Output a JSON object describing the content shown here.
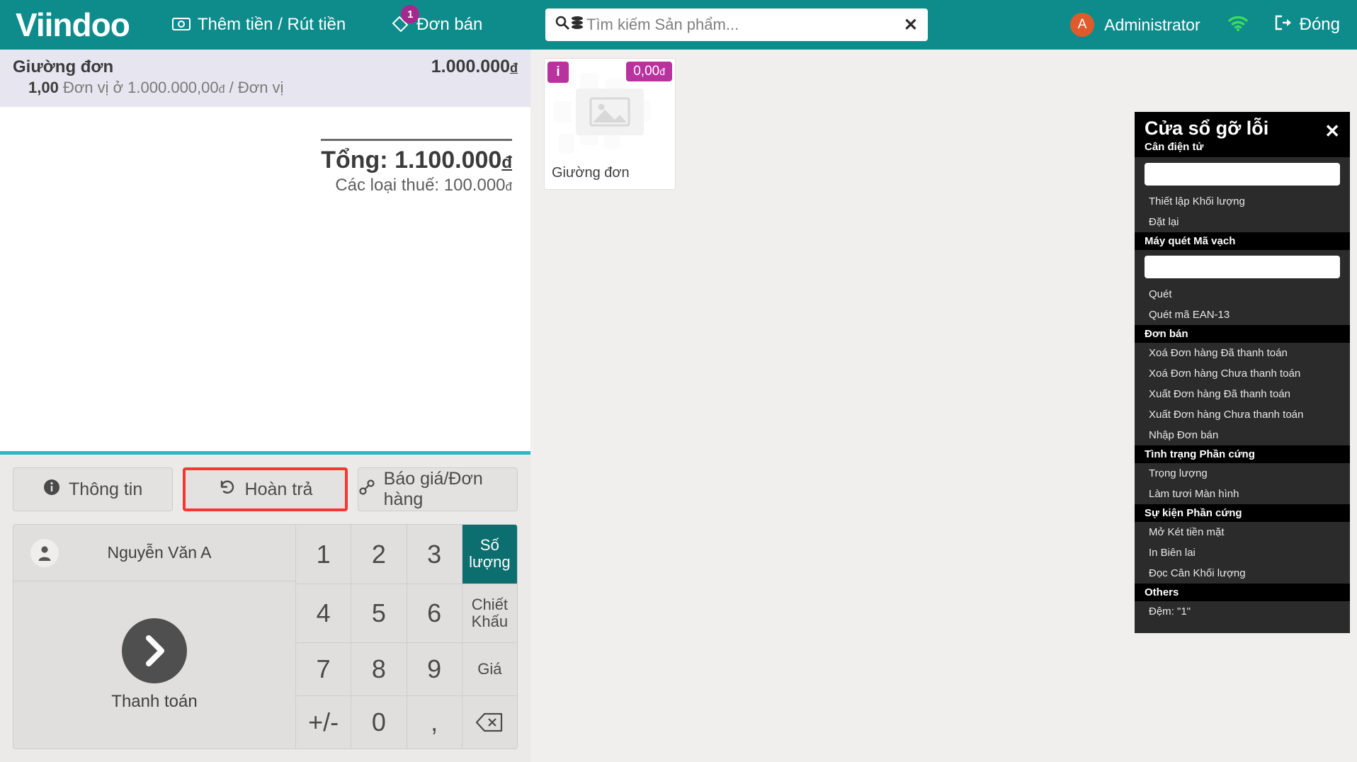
{
  "header": {
    "brand": "Viindoo",
    "cash_in_out_label": "Thêm tiền / Rút tiền",
    "cash_icon": "banknote-icon",
    "orders_label": "Đơn bán",
    "orders_icon": "ticket-icon",
    "orders_badge": "1",
    "search_placeholder": "Tìm kiếm Sản phẩm...",
    "search_value": "",
    "search_icon": "search-icon",
    "database_icon": "database-icon",
    "clear_icon": "close-icon",
    "user_initial": "A",
    "user_name": "Administrator",
    "wifi_icon": "wifi-icon",
    "close_label": "Đóng",
    "close_icon": "logout-icon",
    "accent_color": "#0e8c8c",
    "badge_color": "#a32a8d",
    "avatar_color": "#e05a2b",
    "wifi_color": "#3ddc5a"
  },
  "order": {
    "lines": [
      {
        "name": "Giường đơn",
        "price": "1.000.000",
        "currency": "đ",
        "qty": "1,00",
        "unit_text": "Đơn vị ở",
        "unit_price": "1.000.000,00",
        "per_unit": "/ Đơn vị"
      }
    ],
    "total_label": "Tổng:",
    "total_value": "1.100.000",
    "total_currency": "đ",
    "tax_label": "Các loại thuế:",
    "tax_value": "100.000",
    "tax_currency": "đ"
  },
  "actions": [
    {
      "label": "Thông tin",
      "icon": "info-icon",
      "highlighted": false
    },
    {
      "label": "Hoàn trả",
      "icon": "refund-icon",
      "highlighted": true
    },
    {
      "label": "Báo giá/Đơn hàng",
      "icon": "link-icon",
      "highlighted": false
    }
  ],
  "customer": {
    "name": "Nguyễn Văn A",
    "icon": "user-icon"
  },
  "pay": {
    "label": "Thanh toán",
    "icon": "chevron-right-icon"
  },
  "numpad": [
    {
      "label": "1",
      "type": "digit"
    },
    {
      "label": "2",
      "type": "digit"
    },
    {
      "label": "3",
      "type": "digit"
    },
    {
      "label": "Số lượng",
      "type": "mode",
      "active": true
    },
    {
      "label": "4",
      "type": "digit"
    },
    {
      "label": "5",
      "type": "digit"
    },
    {
      "label": "6",
      "type": "digit"
    },
    {
      "label": "Chiết Khấu",
      "type": "mode",
      "active": false
    },
    {
      "label": "7",
      "type": "digit"
    },
    {
      "label": "8",
      "type": "digit"
    },
    {
      "label": "9",
      "type": "digit"
    },
    {
      "label": "Giá",
      "type": "mode",
      "active": false
    },
    {
      "label": "+/-",
      "type": "digit"
    },
    {
      "label": "0",
      "type": "digit"
    },
    {
      "label": ",",
      "type": "digit"
    },
    {
      "label": "⌫",
      "type": "backspace",
      "icon": "backspace-icon"
    }
  ],
  "products": [
    {
      "name": "Giường đơn",
      "price": "0,00",
      "currency": "đ",
      "info_icon": "info-icon",
      "image": "placeholder-image-icon"
    }
  ],
  "debug": {
    "title": "Cửa sổ gỡ lỗi",
    "close_icon": "close-icon",
    "sections": [
      {
        "title": "Cân điện tử",
        "input": {
          "value": "",
          "placeholder": ""
        },
        "items": [
          "Thiết lập Khối lượng",
          "Đặt lại"
        ]
      },
      {
        "title": "Máy quét Mã vạch",
        "input": {
          "value": "",
          "placeholder": ""
        },
        "items": [
          "Quét",
          "Quét mã EAN-13"
        ]
      },
      {
        "title": "Đơn bán",
        "items": [
          "Xoá Đơn hàng Đã thanh toán",
          "Xoá Đơn hàng Chưa thanh toán",
          "Xuất Đơn hàng Đã thanh toán",
          "Xuất Đơn hàng Chưa thanh toán",
          "Nhập Đơn bán"
        ]
      },
      {
        "title": "Tình trạng Phần cứng",
        "items": [
          "Trọng lượng",
          "Làm tươi Màn hình"
        ]
      },
      {
        "title": "Sự kiện Phần cứng",
        "items": [
          "Mở Két tiền mặt",
          "In Biên lai",
          "Đọc Cân Khối lượng"
        ]
      },
      {
        "title": "Others",
        "items": [
          "Đệm: \"1\""
        ]
      }
    ]
  }
}
